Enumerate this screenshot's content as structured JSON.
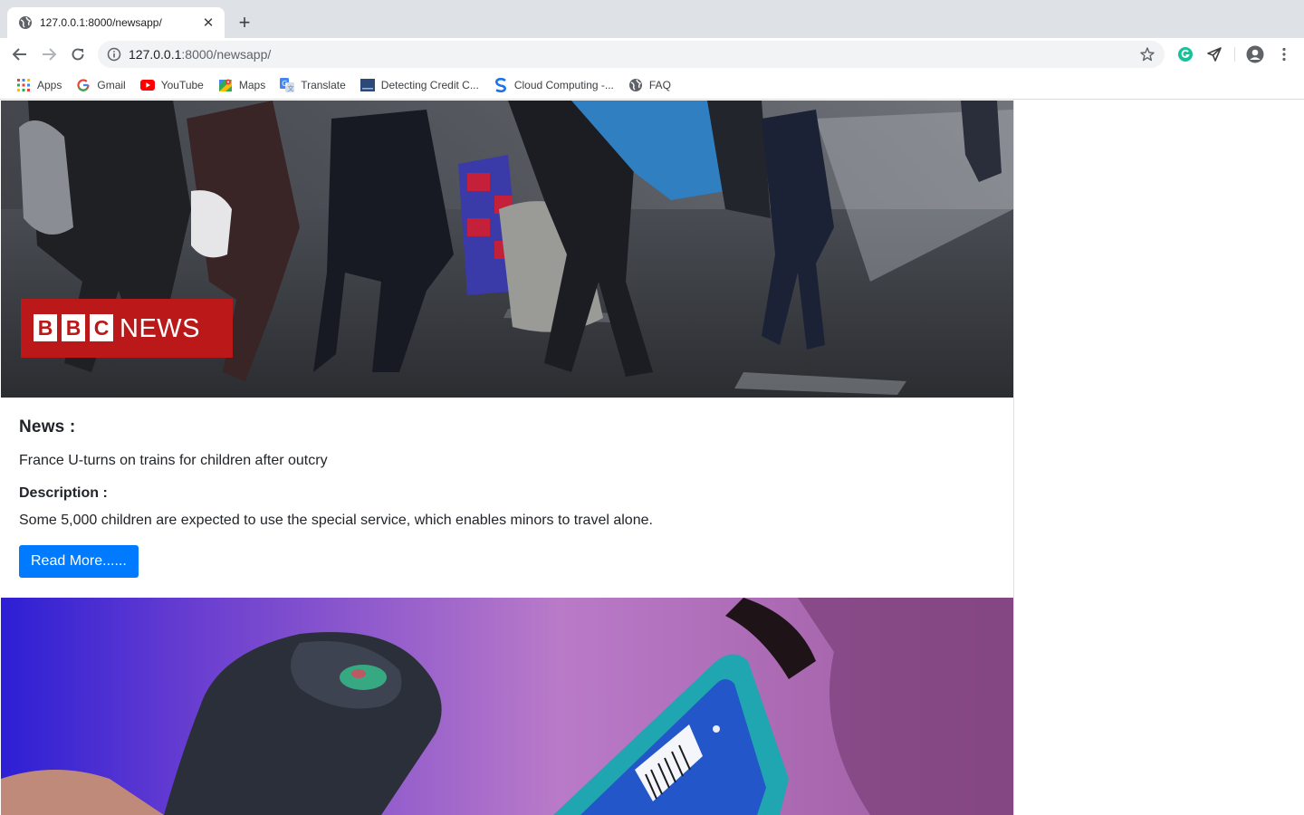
{
  "tab": {
    "title": "127.0.0.1:8000/newsapp/",
    "favicon": "globe-icon"
  },
  "omnibox": {
    "url_host": "127.0.0.1",
    "url_path": ":8000/newsapp/"
  },
  "bookmarks": [
    {
      "label": "Apps",
      "icon": "apps-grid-icon"
    },
    {
      "label": "Gmail",
      "icon": "google-icon"
    },
    {
      "label": "YouTube",
      "icon": "youtube-icon"
    },
    {
      "label": "Maps",
      "icon": "maps-icon"
    },
    {
      "label": "Translate",
      "icon": "translate-icon"
    },
    {
      "label": "Detecting Credit C...",
      "icon": "page-icon"
    },
    {
      "label": "Cloud Computing -...",
      "icon": "s-logo-icon"
    },
    {
      "label": "FAQ",
      "icon": "globe-icon"
    }
  ],
  "articles": [
    {
      "image_logo_text": "BBC NEWS",
      "news_label": "News :",
      "title": "France U-turns on trains for children after outcry",
      "description_label": "Description :",
      "description": "Some 5,000 children are expected to use the special service, which enables minors to travel alone.",
      "button_label": "Read More......"
    }
  ],
  "colors": {
    "primary_button": "#007bff",
    "tabstrip": "#dee1e6",
    "bbc_red": "#bb1919"
  }
}
